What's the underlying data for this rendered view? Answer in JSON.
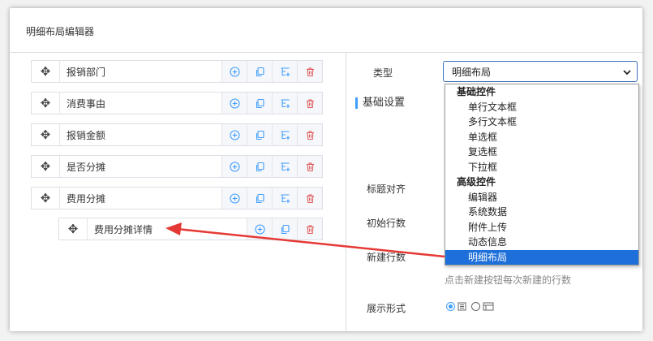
{
  "title": "明细布局编辑器",
  "rows": [
    {
      "label": "报销部门"
    },
    {
      "label": "消费事由"
    },
    {
      "label": "报销金额"
    },
    {
      "label": "是否分摊"
    },
    {
      "label": "费用分摊"
    }
  ],
  "child_row": {
    "label": "费用分摊详情"
  },
  "colors": {
    "accent": "#409eff",
    "delete": "#e05a5a",
    "arrow": "#e53935",
    "selected": "#1e6fd9"
  },
  "form": {
    "type_label": "类型",
    "type_value": "明细布局",
    "section_title": "基础设置",
    "title_align_label": "标题对齐",
    "initial_rows_label": "初始行数",
    "new_rows_label": "新建行数",
    "new_rows_hint": "点击新建按钮每次新建的行数",
    "display_label": "展示形式"
  },
  "dropdown": {
    "group1": "基础控件",
    "group1_items": [
      "单行文本框",
      "多行文本框",
      "单选框",
      "复选框",
      "下拉框"
    ],
    "group2": "高级控件",
    "group2_items": [
      "编辑器",
      "系统数据",
      "附件上传",
      "动态信息",
      "明细布局"
    ],
    "selected": "明细布局"
  },
  "icons": [
    "move-icon",
    "add-circle-icon",
    "copy-icon",
    "add-child-icon",
    "delete-icon",
    "chevron-down-icon",
    "list-view-icon",
    "grid-view-icon"
  ]
}
